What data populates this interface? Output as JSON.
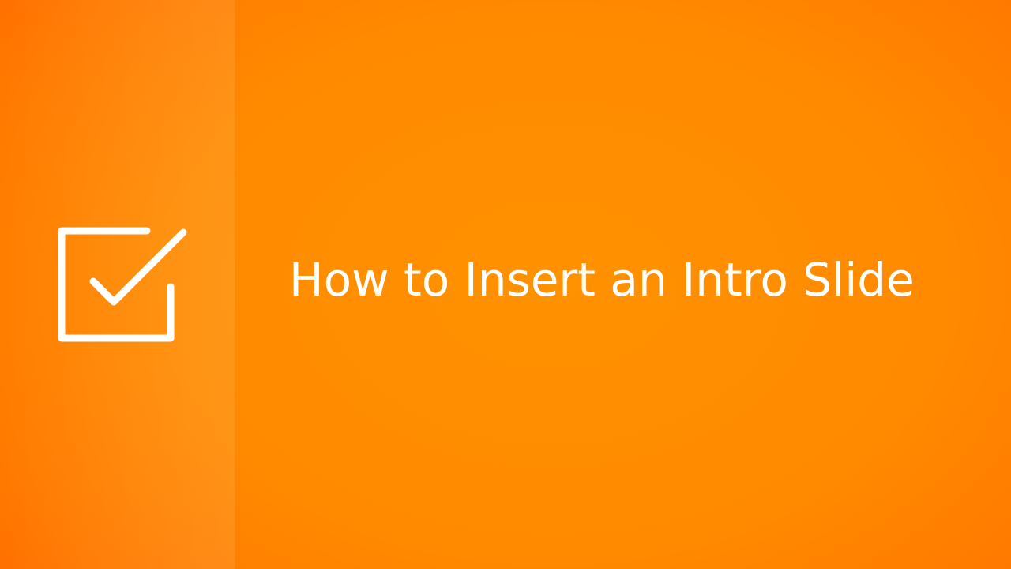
{
  "slide": {
    "title": "How to Insert an Intro Slide",
    "icon": "checkbox-checked-icon",
    "colors": {
      "background": "#ff8a00",
      "background_edge": "#ff6e00",
      "foreground": "#ffffff"
    }
  }
}
